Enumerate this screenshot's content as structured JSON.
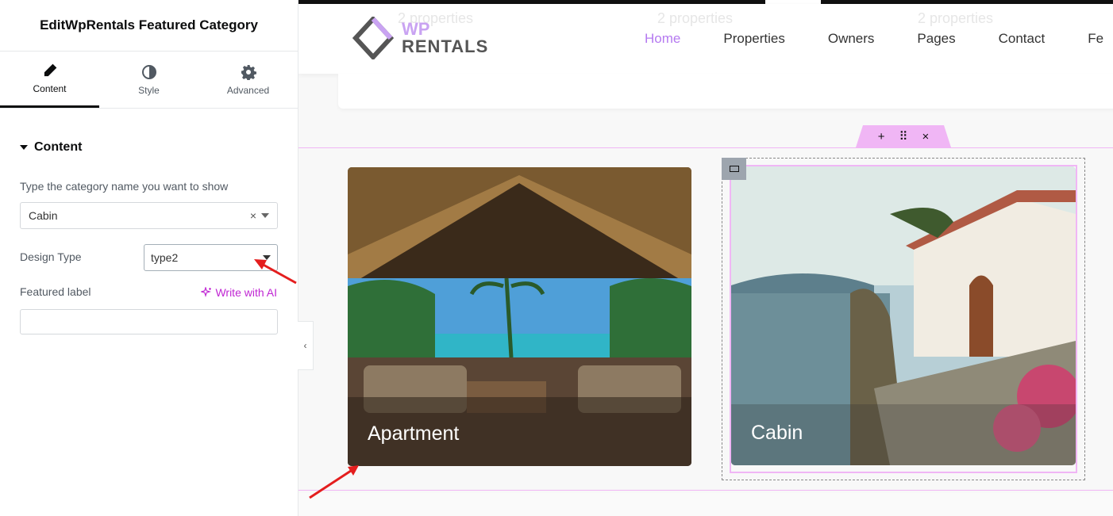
{
  "panel": {
    "title": "EditWpRentals Featured Category",
    "tabs": [
      {
        "label": "Content",
        "icon": "pencil-icon",
        "active": true
      },
      {
        "label": "Style",
        "icon": "half-circle-icon",
        "active": false
      },
      {
        "label": "Advanced",
        "icon": "gear-icon",
        "active": false
      }
    ],
    "section_title": "Content",
    "category_field": {
      "label": "Type the category name you want to show",
      "value": "Cabin"
    },
    "design_type": {
      "label": "Design Type",
      "value": "type2"
    },
    "featured_label": {
      "label": "Featured label",
      "ai_button": "Write with AI",
      "value": ""
    }
  },
  "preview": {
    "ghost_text": [
      "2 properties",
      "2 properties",
      "2 properties"
    ],
    "logo": {
      "line1": "WP",
      "line2": "RENTALS"
    },
    "nav": [
      "Home",
      "Properties",
      "Owners",
      "Pages",
      "Contact",
      "Fe"
    ],
    "nav_active": "Home",
    "section_toolbar": {
      "add": "+",
      "move": "⠿",
      "close": "×"
    },
    "cards": [
      {
        "label": "Apartment"
      },
      {
        "label": "Cabin"
      }
    ]
  },
  "colors": {
    "accent": "#b57af0",
    "editor_pink": "#f0b6f5",
    "ai_magenta": "#c026d3",
    "annotation_red": "#e41e1e"
  }
}
